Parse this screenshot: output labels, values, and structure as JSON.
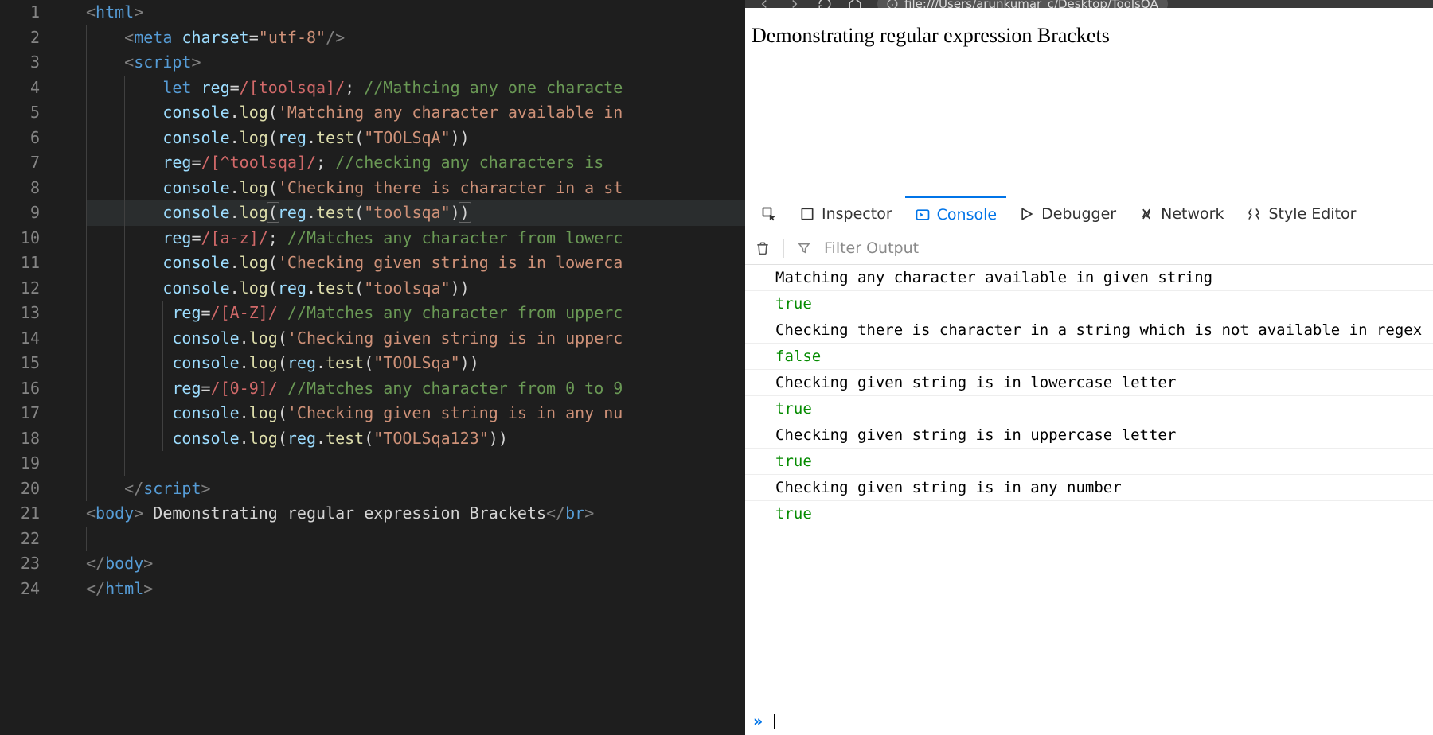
{
  "editor": {
    "lines": [
      "1",
      "2",
      "3",
      "4",
      "5",
      "6",
      "7",
      "8",
      "9",
      "10",
      "11",
      "12",
      "13",
      "14",
      "15",
      "16",
      "17",
      "18",
      "19",
      "20",
      "21",
      "22",
      "23",
      "24"
    ],
    "code": {
      "l1": {
        "open": "<",
        "tag": "html",
        "close": ">"
      },
      "l2": {
        "open": "<",
        "tag": "meta",
        "sp": " ",
        "attr": "charset",
        "eq": "=",
        "val": "\"utf-8\"",
        "end": "/>"
      },
      "l3": {
        "open": "<",
        "tag": "script",
        "close": ">"
      },
      "l4": {
        "kw": "let",
        "sp": " ",
        "var": "reg",
        "eq": "=",
        "regex": "/[toolsqa]/",
        "semi": ";",
        "sp2": " ",
        "comment": "//Mathcing any one characte"
      },
      "l5": {
        "obj": "console",
        "dot": ".",
        "fn": "log",
        "p1": "(",
        "str": "'Matching any character available in"
      },
      "l6": {
        "obj": "console",
        "dot": ".",
        "fn": "log",
        "p1": "(",
        "obj2": "reg",
        "dot2": ".",
        "fn2": "test",
        "p2": "(",
        "str": "\"TOOLSqA\"",
        "p3": ")",
        ")": ")"
      },
      "l7": {
        "var": "reg",
        "eq": "=",
        "regex": "/[^toolsqa]/",
        "semi": ";",
        "sp": " ",
        "comment": "//checking any characters is "
      },
      "l8": {
        "obj": "console",
        "dot": ".",
        "fn": "log",
        "p1": "(",
        "str": "'Checking there is character in a st"
      },
      "l9": {
        "obj": "console",
        "dot": ".",
        "fn": "log",
        "p1": "(",
        "obj2": "reg",
        "dot2": ".",
        "fn2": "test",
        "p2": "(",
        "str": "\"toolsqa\"",
        "p3": ")",
        ")": ")"
      },
      "l10": {
        "var": "reg",
        "eq": "=",
        "regex": "/[a-z]/",
        "semi": ";",
        "sp": " ",
        "comment": "//Matches any character from lowerc"
      },
      "l11": {
        "obj": "console",
        "dot": ".",
        "fn": "log",
        "p1": "(",
        "str": "'Checking given string is in lowerca"
      },
      "l12": {
        "obj": "console",
        "dot": ".",
        "fn": "log",
        "p1": "(",
        "obj2": "reg",
        "dot2": ".",
        "fn2": "test",
        "p2": "(",
        "str": "\"toolsqa\"",
        "p3": ")",
        ")": ")"
      },
      "l13": {
        "var": "reg",
        "eq": "=",
        "regex": "/[A-Z]/",
        "sp": " ",
        "comment": "//Matches any character from upperc"
      },
      "l14": {
        "obj": "console",
        "dot": ".",
        "fn": "log",
        "p1": "(",
        "str": "'Checking given string is in upperc"
      },
      "l15": {
        "obj": "console",
        "dot": ".",
        "fn": "log",
        "p1": "(",
        "obj2": "reg",
        "dot2": ".",
        "fn2": "test",
        "p2": "(",
        "str": "\"TOOLSqa\"",
        "p3": ")",
        ")": ")"
      },
      "l16": {
        "var": "reg",
        "eq": "=",
        "regex": "/[0-9]/",
        "sp": " ",
        "comment": "//Matches any character from 0 to 9"
      },
      "l17": {
        "obj": "console",
        "dot": ".",
        "fn": "log",
        "p1": "(",
        "str": "'Checking given string is in any nu"
      },
      "l18": {
        "obj": "console",
        "dot": ".",
        "fn": "log",
        "p1": "(",
        "obj2": "reg",
        "dot2": ".",
        "fn2": "test",
        "p2": "(",
        "str": "\"TOOLSqa123\"",
        "p3": ")",
        ")": ")"
      },
      "l20": {
        "open": "</",
        "tag": "script",
        "close": ">"
      },
      "l21": {
        "open": "<",
        "tag": "body",
        "close": ">",
        "txt": " Demonstrating regular expression Brackets",
        "open2": "</",
        "tag2": "br",
        "close2": ">"
      },
      "l23": {
        "open": "</",
        "tag": "body",
        "close": ">"
      },
      "l24": {
        "open": "</",
        "tag": "html",
        "close": ">"
      }
    }
  },
  "browser": {
    "url": "file:///Users/arunkumar_c/Desktop/ToolsQA",
    "page_heading": "Demonstrating regular expression Brackets",
    "devtools": {
      "tabs": {
        "inspector": "Inspector",
        "console": "Console",
        "debugger": "Debugger",
        "network": "Network",
        "style": "Style Editor"
      },
      "filter_placeholder": "Filter Output",
      "console_rows": [
        {
          "text": "Matching any character available in given string",
          "kind": "text"
        },
        {
          "text": "true",
          "kind": "bool"
        },
        {
          "text": "Checking there is character in a string which is not available in regex",
          "kind": "text"
        },
        {
          "text": "false",
          "kind": "bool"
        },
        {
          "text": "Checking given string is in lowercase letter",
          "kind": "text"
        },
        {
          "text": "true",
          "kind": "bool"
        },
        {
          "text": "Checking given string is in uppercase letter",
          "kind": "text"
        },
        {
          "text": "true",
          "kind": "bool"
        },
        {
          "text": "Checking given string is in any number",
          "kind": "text"
        },
        {
          "text": "true",
          "kind": "bool"
        }
      ],
      "prompt_symbol": "»"
    }
  }
}
